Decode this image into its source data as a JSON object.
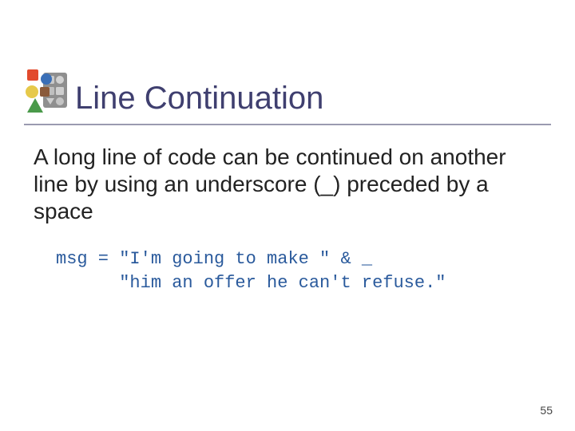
{
  "title": "Line Continuation",
  "body": "A long line of code can be continued on another line by using an  underscore (_) preceded by a space",
  "code": "msg = \"I'm going to make \" & _\n      \"him an offer he can't refuse.\"",
  "page_number": "55"
}
